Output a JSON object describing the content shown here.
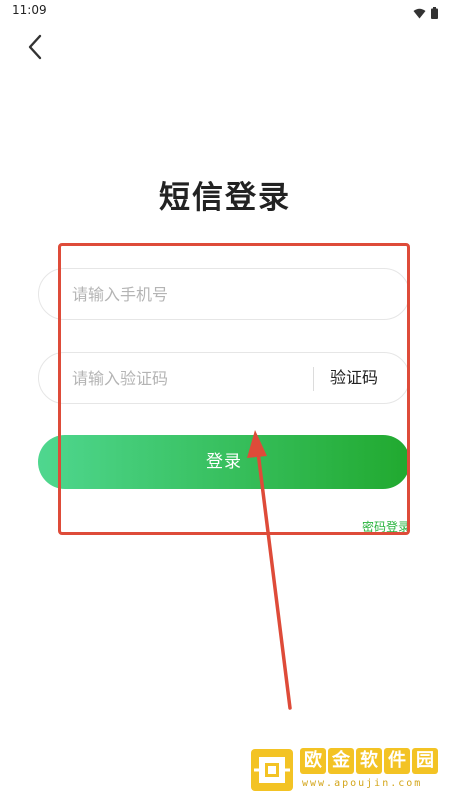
{
  "status_bar": {
    "time": "11:09",
    "icons": [
      "wifi-icon",
      "battery-icon"
    ]
  },
  "header": {
    "back_icon": "chevron-left-icon"
  },
  "title": "短信登录",
  "phone_input": {
    "placeholder": "请输入手机号",
    "value": ""
  },
  "code_input": {
    "placeholder": "请输入验证码",
    "value": "",
    "get_code_label": "验证码"
  },
  "login_button": {
    "label": "登录"
  },
  "password_login_link": "密码登录",
  "colors": {
    "accent_start": "#4fd78f",
    "accent_end": "#21a92f",
    "link": "#27b43c",
    "annotation": "#de4b39",
    "watermark": "#f3c324"
  },
  "watermark": {
    "chars": [
      "欧",
      "金",
      "软",
      "件",
      "园"
    ],
    "url": "www.apoujin.com"
  }
}
